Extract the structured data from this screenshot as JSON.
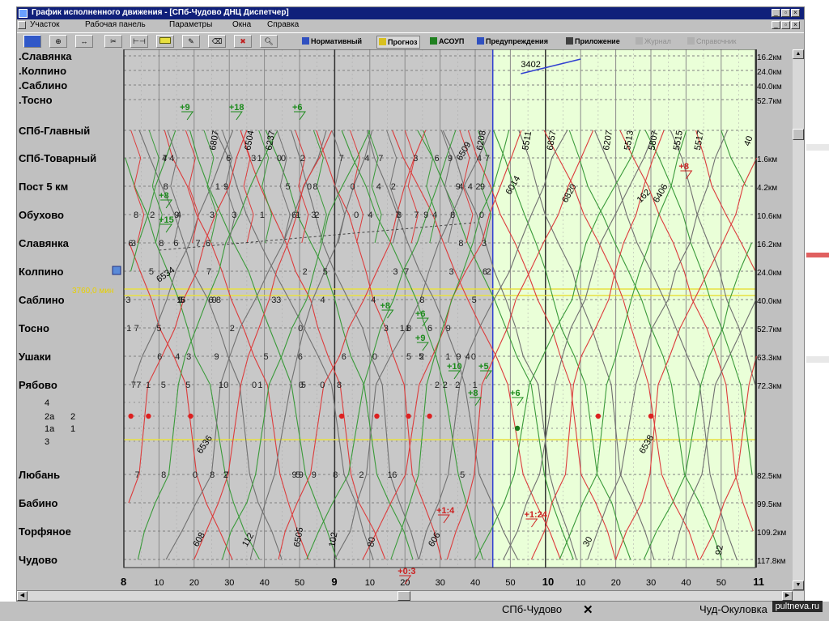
{
  "window": {
    "title": "График исполненного движения - [СПб-Чудово ДНЦ Диспетчер]",
    "controls": [
      "_",
      "▫",
      "×"
    ]
  },
  "menu": [
    "Участок",
    "Рабочая панель",
    "Параметры",
    "Окна",
    "Справка"
  ],
  "toolbar": {
    "icon_buttons": [
      "grid-icon",
      "zoom-icon",
      "fit-width-icon",
      "cut-icon",
      "range-icon",
      "highlight-icon",
      "draw-icon",
      "erase-icon",
      "delete-icon",
      "zoom-in-icon"
    ],
    "modes": [
      {
        "label": "Нормативный",
        "enabled": true,
        "icon": "#3050c0"
      },
      {
        "label": "Прогноз",
        "enabled": true,
        "icon": "#d8c020"
      },
      {
        "label": "АСОУП",
        "enabled": true,
        "icon": "#208020"
      },
      {
        "label": "Предупреждения",
        "enabled": true,
        "icon": "#3050c0"
      },
      {
        "label": "Приложение",
        "enabled": true,
        "icon": "#404040"
      },
      {
        "label": "Журнал",
        "enabled": false,
        "icon": "#909090"
      },
      {
        "label": "Справочник",
        "enabled": false,
        "icon": "#909090"
      }
    ]
  },
  "stations_top": [
    {
      "name": ".Славянка",
      "km": "16.2км"
    },
    {
      "name": ".Колпино",
      "km": "24.0км"
    },
    {
      "name": ".Саблино",
      "km": "40.0км"
    },
    {
      "name": ".Тосно",
      "km": "52.7км"
    }
  ],
  "stations": [
    {
      "name": "СПб-Главный",
      "km": ""
    },
    {
      "name": "СПб-Товарный",
      "km": "1.6км"
    },
    {
      "name": "Пост 5 км",
      "km": "4.2км"
    },
    {
      "name": "Обухово",
      "km": "10.6км"
    },
    {
      "name": "Славянка",
      "km": "16.2км"
    },
    {
      "name": "Колпино",
      "km": "24.0км"
    },
    {
      "name": "Саблино",
      "km": "40.0км"
    },
    {
      "name": "Тосно",
      "km": "52.7км"
    },
    {
      "name": "Ушаки",
      "km": "63.3км"
    },
    {
      "name": "Рябово",
      "km": "72.3км"
    },
    {
      "name": "Любань",
      "km": "82.5км"
    },
    {
      "name": "Бабино",
      "km": "99.5км"
    },
    {
      "name": "Торфяное",
      "km": "109.2км"
    },
    {
      "name": "Чудово",
      "km": "117.8км"
    }
  ],
  "tracks": [
    {
      "left": "4",
      "right": ""
    },
    {
      "left": "2а",
      "right": "2"
    },
    {
      "left": "1а",
      "right": "1"
    },
    {
      "left": "3",
      "right": ""
    }
  ],
  "time_axis": {
    "major": [
      {
        "label": "8",
        "at": 0
      },
      {
        "label": "9",
        "at": 60
      },
      {
        "label": "10",
        "at": 120
      },
      {
        "label": "11",
        "at": 180
      }
    ],
    "minor_labels": [
      "10",
      "20",
      "30",
      "40",
      "50"
    ],
    "now_minute": 105
  },
  "train_numbers": [
    "3402",
    "6534",
    "6536",
    "6538",
    "6014",
    "6820",
    "6406",
    "5511",
    "6857",
    "6207",
    "5513",
    "5807",
    "5515",
    "5517",
    "6237",
    "6504",
    "6807",
    "6208",
    "6509",
    "6505",
    "606",
    "608",
    "112",
    "102",
    "80",
    "30",
    "92",
    "162",
    "40"
  ],
  "markers": [
    "+9",
    "+18",
    "+6",
    "+8",
    "+15",
    "+8",
    "+6",
    "+9",
    "+10",
    "+5",
    "+8",
    "+6",
    "+1:4",
    "+1:24",
    "+0:3",
    "+8"
  ],
  "window_label": "3760,0 мин",
  "taskbar": [
    {
      "label": "СПб-Чудово"
    },
    {
      "label": "Чуд-Окуловка"
    }
  ],
  "watermark": "pultneva.ru",
  "colors": {
    "titlebar": "#10207a",
    "chart_bg_past": "#c8c8c8",
    "chart_bg_forecast": "#eaffd8",
    "red_lines": "#dc3c3c",
    "green_lines": "#3a9a3a",
    "grey_lines": "#707070",
    "yellow_lines": "#e8e040",
    "now_line": "#3040d0"
  }
}
